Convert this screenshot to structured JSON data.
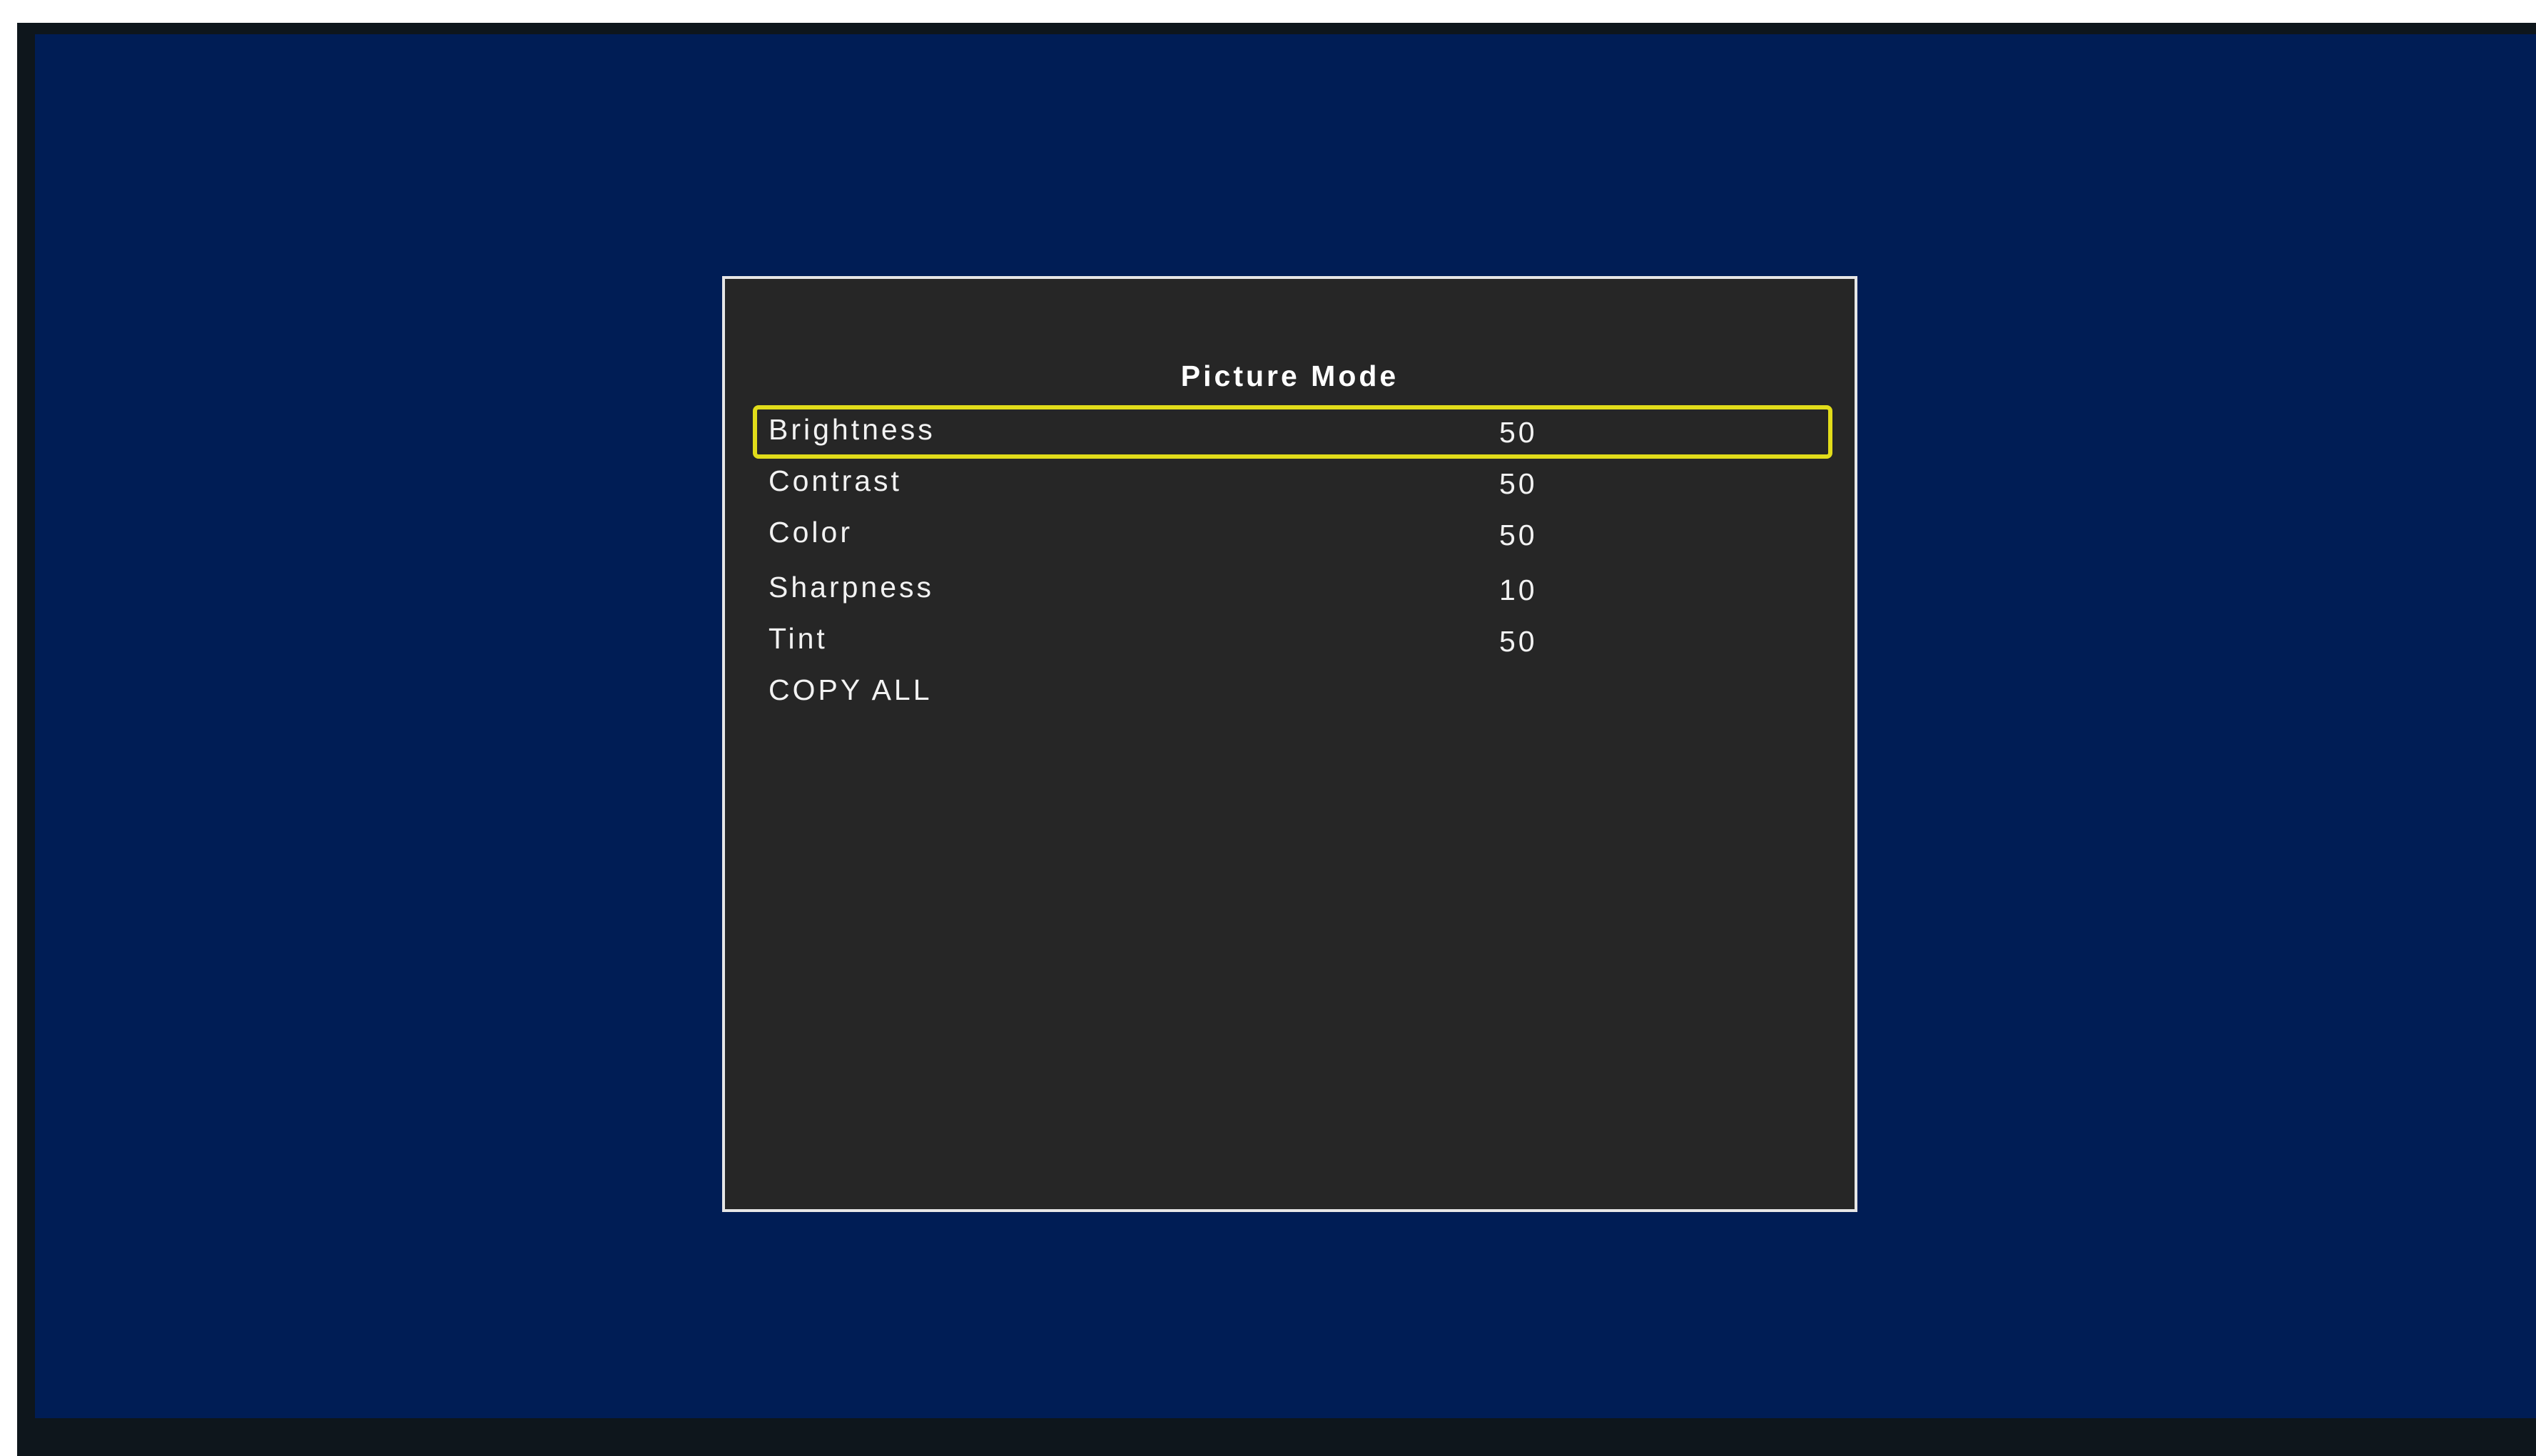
{
  "menu": {
    "title": "Picture Mode",
    "items": [
      {
        "label": "Brightness",
        "value": "50",
        "selected": true
      },
      {
        "label": "Contrast",
        "value": "50"
      },
      {
        "label": "Color",
        "value": "50"
      },
      {
        "label": "Sharpness",
        "value": "10"
      },
      {
        "label": "Tint",
        "value": "50"
      },
      {
        "label": "COPY ALL",
        "value": ""
      }
    ]
  },
  "colors": {
    "screen_background": "#001d55",
    "bezel": "#0e161c",
    "panel_background": "#262626",
    "panel_border": "#e6e6e6",
    "selection_highlight": "#e1dc1a",
    "text": "#f2f2f2"
  }
}
